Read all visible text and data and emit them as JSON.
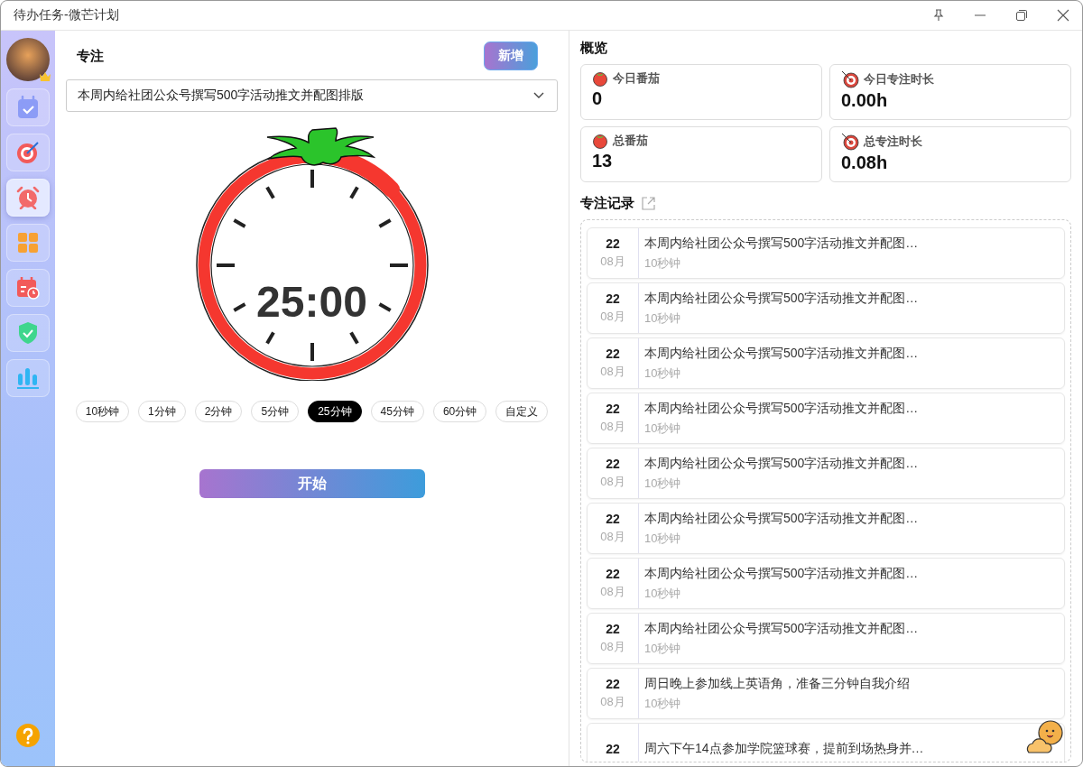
{
  "window": {
    "title": "待办任务-微芒计划"
  },
  "sidebar": {
    "items": [
      {
        "kind": "calendar",
        "selected": false
      },
      {
        "kind": "target",
        "selected": false
      },
      {
        "kind": "alarm",
        "selected": true
      },
      {
        "kind": "grid",
        "selected": false
      },
      {
        "kind": "schedule",
        "selected": false
      },
      {
        "kind": "shield",
        "selected": false
      },
      {
        "kind": "chart",
        "selected": false
      }
    ]
  },
  "focus": {
    "title": "专注",
    "add_button": "新增",
    "task_select": {
      "value": "本周内给社团公众号撰写500字活动推文并配图排版"
    },
    "timer": "25:00",
    "durations": [
      {
        "label": "10秒钟",
        "selected": false
      },
      {
        "label": "1分钟",
        "selected": false
      },
      {
        "label": "2分钟",
        "selected": false
      },
      {
        "label": "5分钟",
        "selected": false
      },
      {
        "label": "25分钟",
        "selected": true
      },
      {
        "label": "45分钟",
        "selected": false
      },
      {
        "label": "60分钟",
        "selected": false
      },
      {
        "label": "自定义",
        "selected": false
      }
    ],
    "start_button": "开始"
  },
  "overview": {
    "title": "概览",
    "stats": [
      {
        "kind": "tomato",
        "label": "今日番茄",
        "value": "0"
      },
      {
        "kind": "target",
        "label": "今日专注时长",
        "value": "0.00h"
      },
      {
        "kind": "tomato",
        "label": "总番茄",
        "value": "13"
      },
      {
        "kind": "target",
        "label": "总专注时长",
        "value": "0.08h"
      }
    ]
  },
  "records": {
    "title": "专注记录",
    "items": [
      {
        "day": "22",
        "month": "08月",
        "task": "本周内给社团公众号撰写500字活动推文并配图…",
        "duration": "10秒钟"
      },
      {
        "day": "22",
        "month": "08月",
        "task": "本周内给社团公众号撰写500字活动推文并配图…",
        "duration": "10秒钟"
      },
      {
        "day": "22",
        "month": "08月",
        "task": "本周内给社团公众号撰写500字活动推文并配图…",
        "duration": "10秒钟"
      },
      {
        "day": "22",
        "month": "08月",
        "task": "本周内给社团公众号撰写500字活动推文并配图…",
        "duration": "10秒钟"
      },
      {
        "day": "22",
        "month": "08月",
        "task": "本周内给社团公众号撰写500字活动推文并配图…",
        "duration": "10秒钟"
      },
      {
        "day": "22",
        "month": "08月",
        "task": "本周内给社团公众号撰写500字活动推文并配图…",
        "duration": "10秒钟"
      },
      {
        "day": "22",
        "month": "08月",
        "task": "本周内给社团公众号撰写500字活动推文并配图…",
        "duration": "10秒钟"
      },
      {
        "day": "22",
        "month": "08月",
        "task": "本周内给社团公众号撰写500字活动推文并配图…",
        "duration": "10秒钟"
      },
      {
        "day": "22",
        "month": "08月",
        "task": "周日晚上参加线上英语角，准备三分钟自我介绍",
        "duration": "10秒钟"
      },
      {
        "day": "22",
        "task": "周六下午14点参加学院篮球赛，提前到场热身并…"
      }
    ]
  }
}
